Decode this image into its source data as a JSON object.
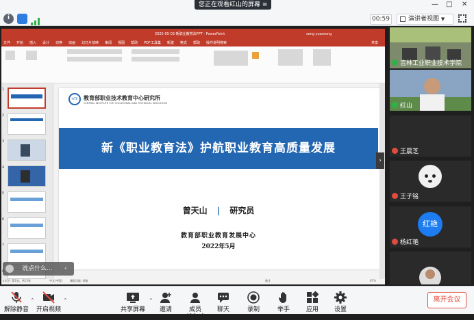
{
  "top": {
    "viewing": "您正在观看红山的屏幕",
    "timer": "00:59",
    "view_mode": "演讲者视图"
  },
  "ppt": {
    "title": "2022-05-03 新职业教育法PPT - PowerPoint",
    "user": "song yuanrong",
    "share": "共享",
    "menu": [
      "文件",
      "开始",
      "插入",
      "设计",
      "切换",
      "动画",
      "幻灯片放映",
      "审阅",
      "视图",
      "帮助",
      "PDF工具集",
      "新建",
      "格式",
      "帮助",
      "操作说明搜索"
    ],
    "status_left": "幻灯片 第1张，共23张",
    "status_lang": "中文(中国)",
    "status_access": "辅助功能: 调查",
    "status_notes": "备注",
    "zoom": "87%"
  },
  "thumb_numbers": [
    "1",
    "2",
    "3",
    "4",
    "5",
    "6",
    "7",
    "8"
  ],
  "slide": {
    "org_cn": "教育部职业技术教育中心研究所",
    "org_en": "CENTRAL INSTITUTE FOR VOCATIONAL AND TECHNICAL EDUCATION",
    "logo": "IVTE",
    "title": "新《职业教育法》护航职业教育高质量发展",
    "presenter": "曾天山",
    "divider": "|",
    "role": "研究员",
    "center": "教育部职业教育发展中心",
    "date": "2022年5月"
  },
  "chat": {
    "placeholder": "说点什么..."
  },
  "participants": [
    {
      "name": "吉林工业职业技术学院"
    },
    {
      "name": "红山"
    },
    {
      "name": "王晨芝"
    },
    {
      "name": "王子铭"
    },
    {
      "name": "杨红艳",
      "avatar": "红艳"
    },
    {
      "name": ""
    }
  ],
  "toolbar": {
    "unmute": "解除静音",
    "video": "开启视频",
    "share": "共享屏幕",
    "invite": "邀请",
    "members": "成员(99+)",
    "chat": "聊天",
    "record": "录制",
    "raise": "举手",
    "apps": "应用",
    "settings": "设置",
    "leave": "离开会议"
  },
  "colors": {
    "accent": "#2367b3",
    "ppt_red": "#c13b2a",
    "leave": "#e04b3f"
  }
}
